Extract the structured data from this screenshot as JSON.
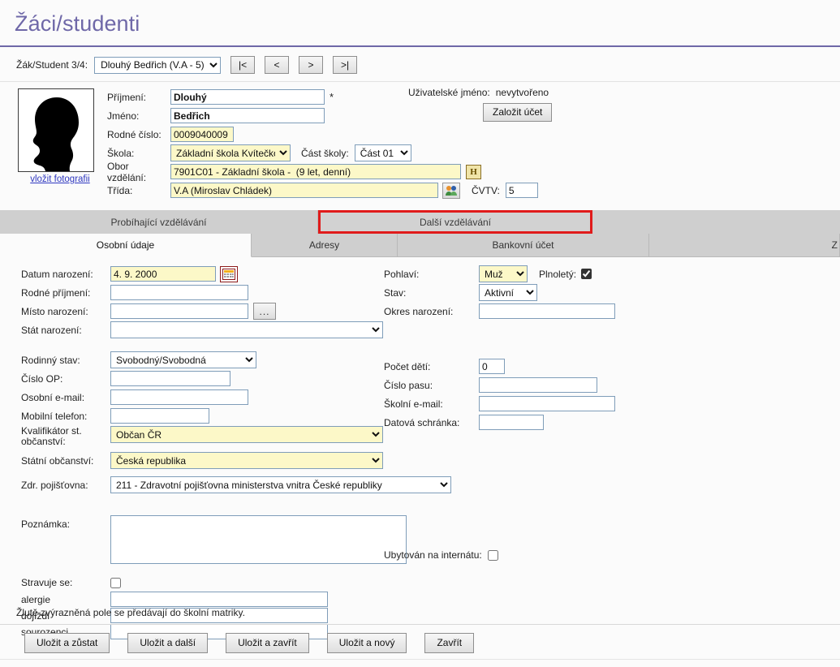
{
  "page": {
    "title": "Žáci/studenti",
    "accent_color": "#6f68a8",
    "highlight_color": "#e01b1b",
    "yellow_field_color": "#fcf8c8"
  },
  "navigator": {
    "label": "Žák/Student 3/4:",
    "selected_record": "Dlouhý Bedřich (V.A - 5)",
    "buttons": {
      "first": "|<",
      "prev": "<",
      "next": ">",
      "last": ">|"
    }
  },
  "photo": {
    "link_label": "vložit fotografii",
    "icon": "person-silhouette-icon"
  },
  "identity": {
    "surname_label": "Příjmení:",
    "surname_value": "Dlouhý",
    "required_marker": "*",
    "firstname_label": "Jméno:",
    "firstname_value": "Bedřich",
    "birth_number_label": "Rodné číslo:",
    "birth_number_value": "0009040009",
    "school_label": "Škola:",
    "school_value": "Základní škola Kvítečkov",
    "school_part_label": "Část školy:",
    "school_part_value": "Část 01",
    "field_of_study_label": "Obor vzdělání:",
    "field_of_study_value": "7901C01 - Základní škola -  (9 let, denní)",
    "history_button_label": "H",
    "class_label": "Třída:",
    "class_value": "V.A (Miroslav Chládek)",
    "class_picker_icon": "two-people-icon",
    "cvtv_label": "ČVTV:",
    "cvtv_value": "5"
  },
  "account": {
    "username_label": "Uživatelské jméno:",
    "username_value": "nevytvořeno",
    "create_account_button": "Založit účet"
  },
  "tabs_primary": [
    {
      "label": "Probíhající vzdělávání",
      "selected": false
    },
    {
      "label": "Další vzdělávání",
      "selected": true
    }
  ],
  "tabs_secondary": [
    {
      "label": "Osobní údaje",
      "active": true
    },
    {
      "label": "Adresy",
      "active": false
    },
    {
      "label": "Bankovní účet",
      "active": false
    },
    {
      "label": "Z",
      "active": false
    }
  ],
  "form": {
    "left": {
      "birth_date_label": "Datum narození:",
      "birth_date_value": "4. 9. 2000",
      "calendar_icon": "calendar-icon",
      "birth_surname_label": "Rodné příjmení:",
      "birth_surname_value": "",
      "birth_place_label": "Místo narození:",
      "birth_place_value": "",
      "birth_place_picker": "...",
      "birth_country_label": "Stát narození:",
      "birth_country_value": "",
      "marital_status_label": "Rodinný stav:",
      "marital_status_value": "Svobodný/Svobodná",
      "id_card_label": "Číslo OP:",
      "id_card_value": "",
      "personal_email_label": "Osobní e-mail:",
      "personal_email_value": "",
      "mobile_label": "Mobilní telefon:",
      "mobile_value": "",
      "citizenship_qualifier_label_1": "Kvalifikátor st.",
      "citizenship_qualifier_label_2": "občanství:",
      "citizenship_qualifier_value": "Občan ČR",
      "citizenship_label": "Státní občanství:",
      "citizenship_value": "Česká republika",
      "insurance_label": "Zdr. pojišťovna:",
      "insurance_value": "211 - Zdravotní pojišťovna ministerstva vnitra České republiky",
      "note_label": "Poznámka:",
      "note_value": "",
      "meals_label": "Stravuje se:",
      "meals_checked": false,
      "allergy_label": "alergie",
      "allergy_value": "",
      "commute_label": "dojíždí",
      "commute_value": "",
      "siblings_label": "sourozenci",
      "siblings_value": ""
    },
    "right": {
      "gender_label": "Pohlaví:",
      "gender_value": "Muž",
      "adult_label": "Plnoletý:",
      "adult_checked": true,
      "status_label": "Stav:",
      "status_value": "Aktivní",
      "birth_district_label": "Okres narození:",
      "birth_district_value": "",
      "children_count_label": "Počet dětí:",
      "children_count_value": "0",
      "passport_label": "Číslo pasu:",
      "passport_value": "",
      "school_email_label": "Školní e-mail:",
      "school_email_value": "",
      "data_box_label": "Datová schránka:",
      "data_box_value": "",
      "dormitory_label": "Ubytován na internátu:",
      "dormitory_checked": false
    }
  },
  "footer": {
    "note": "Žlutě zvýrazněná pole se předávají do školní matriky.",
    "buttons": [
      "Uložit a zůstat",
      "Uložit a další",
      "Uložit a zavřít",
      "Uložit a nový",
      "Zavřít"
    ]
  }
}
